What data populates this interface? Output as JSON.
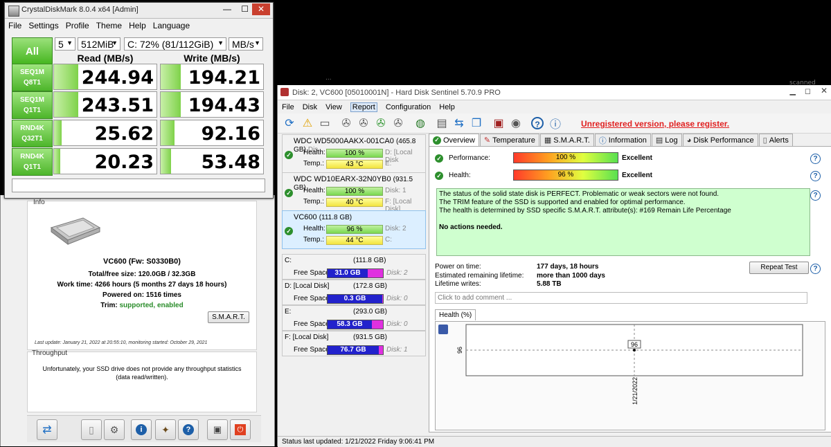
{
  "desktop": {
    "stray_texts": [
      "...",
      "scanned"
    ]
  },
  "cdm": {
    "title": "CrystalDiskMark 8.0.4 x64 [Admin]",
    "menu": [
      "File",
      "Settings",
      "Profile",
      "Theme",
      "Help",
      "Language"
    ],
    "all_label": "All",
    "count": "5",
    "size": "512MiB",
    "drive": "C: 72% (81/112GiB)",
    "unit": "MB/s",
    "read_header": "Read (MB/s)",
    "write_header": "Write (MB/s)",
    "rows": [
      {
        "l1": "SEQ1M",
        "l2": "Q8T1",
        "read": "244.94",
        "write": "194.21",
        "read_frac": 0.23,
        "write_frac": 0.19
      },
      {
        "l1": "SEQ1M",
        "l2": "Q1T1",
        "read": "243.51",
        "write": "194.43",
        "read_frac": 0.23,
        "write_frac": 0.19
      },
      {
        "l1": "RND4K",
        "l2": "Q32T1",
        "read": "25.62",
        "write": "92.16",
        "read_frac": 0.07,
        "write_frac": 0.13
      },
      {
        "l1": "RND4K",
        "l2": "Q1T1",
        "read": "20.23",
        "write": "53.48",
        "read_frac": 0.06,
        "write_frac": 0.1
      }
    ]
  },
  "hds_left": {
    "info_label": "Info",
    "drive_name": "VC600 (Fw: S0330B0)",
    "total_free": "Total/free size: 120.0GB / 32.3GB",
    "work_time": "Work time: 4266 hours (5 months 27 days 18 hours)",
    "powered_on": "Powered on: 1516 times",
    "trim_label": "Trim:",
    "trim_value": "supported, enabled",
    "smart_button": "S.M.A.R.T.",
    "last_update": "Last update: January 21, 2022 at 20:55:10, monitoring started: October 29, 2021",
    "throughput_label": "Throughput",
    "throughput_msg1": "Unfortunately, your SSD drive does not provide any throughput statistics",
    "throughput_msg2": "(data read/written)."
  },
  "hds": {
    "title": "Disk: 2, VC600 [05010001N]  -  Hard Disk Sentinel 5.70.9 PRO",
    "menu": [
      "File",
      "Disk",
      "View",
      "Report",
      "Configuration",
      "Help"
    ],
    "unregistered": "Unregistered version, please register.",
    "disks": [
      {
        "name": "WDC WD5000AAKX-001CA0",
        "size": "(465.8 GB)",
        "disk": "Dis",
        "health": "100 %",
        "temp": "43 °C",
        "hinfo": "D: [Local Disk",
        "tinfo": "E:"
      },
      {
        "name": "WDC WD10EARX-32N0YB0",
        "size": "(931.5 GB)",
        "disk": "",
        "health": "100 %",
        "temp": "40 °C",
        "hinfo": "Disk: 1",
        "tinfo": "F: [Local Disk]"
      },
      {
        "name": "VC600",
        "size": "(111.8 GB)",
        "disk": "",
        "health": "96 %",
        "temp": "44 °C",
        "hinfo": "Disk: 2",
        "tinfo": "C:"
      }
    ],
    "health_label": "Health:",
    "temp_label": "Temp.:",
    "partitions": [
      {
        "name": "C:",
        "size": "(111.8 GB)",
        "free": "31.0 GB",
        "disk": "Disk: 2",
        "used_frac": 0.72
      },
      {
        "name": "D: [Local Disk]",
        "size": "(172.8 GB)",
        "free": "0.3 GB",
        "disk": "Disk: 0",
        "used_frac": 0.99
      },
      {
        "name": "E:",
        "size": "(293.0 GB)",
        "free": "58.3 GB",
        "disk": "Disk: 0",
        "used_frac": 0.8
      },
      {
        "name": "F: [Local Disk]",
        "size": "(931.5 GB)",
        "free": "76.7 GB",
        "disk": "Disk: 1",
        "used_frac": 0.92
      }
    ],
    "free_space_label": "Free Space",
    "tabs": [
      "Overview",
      "Temperature",
      "S.M.A.R.T.",
      "Information",
      "Log",
      "Disk Performance",
      "Alerts"
    ],
    "performance_label": "Performance:",
    "performance_value": "100 %",
    "performance_rating": "Excellent",
    "health_label2": "Health:",
    "health_value": "96 %",
    "health_rating": "Excellent",
    "status_lines": [
      "The status of the solid state disk is PERFECT. Problematic or weak sectors were not found.",
      "The TRIM feature of the SSD is supported and enabled for optimal performance.",
      "The health is determined by SSD specific S.M.A.R.T. attribute(s):  #169 Remain Life Percentage"
    ],
    "no_actions": "No actions needed.",
    "power_on_label": "Power on time:",
    "power_on_value": "177 days, 18 hours",
    "remaining_label": "Estimated remaining lifetime:",
    "remaining_value": "more than 1000 days",
    "writes_label": "Lifetime writes:",
    "writes_value": "5.88 TB",
    "repeat_test": "Repeat Test",
    "comment_placeholder": "Click to add comment ...",
    "chart_tab": "Health (%)",
    "status_bar": "Status last updated: 1/21/2022 Friday 9:06:41 PM"
  },
  "chart_data": {
    "type": "line",
    "title": "",
    "xlabel": "",
    "ylabel": "",
    "x": [
      "1/21/2022"
    ],
    "series": [
      {
        "values": [
          96
        ]
      }
    ],
    "point_labels": [
      "96"
    ],
    "y_tick_labels": [
      "96"
    ]
  }
}
